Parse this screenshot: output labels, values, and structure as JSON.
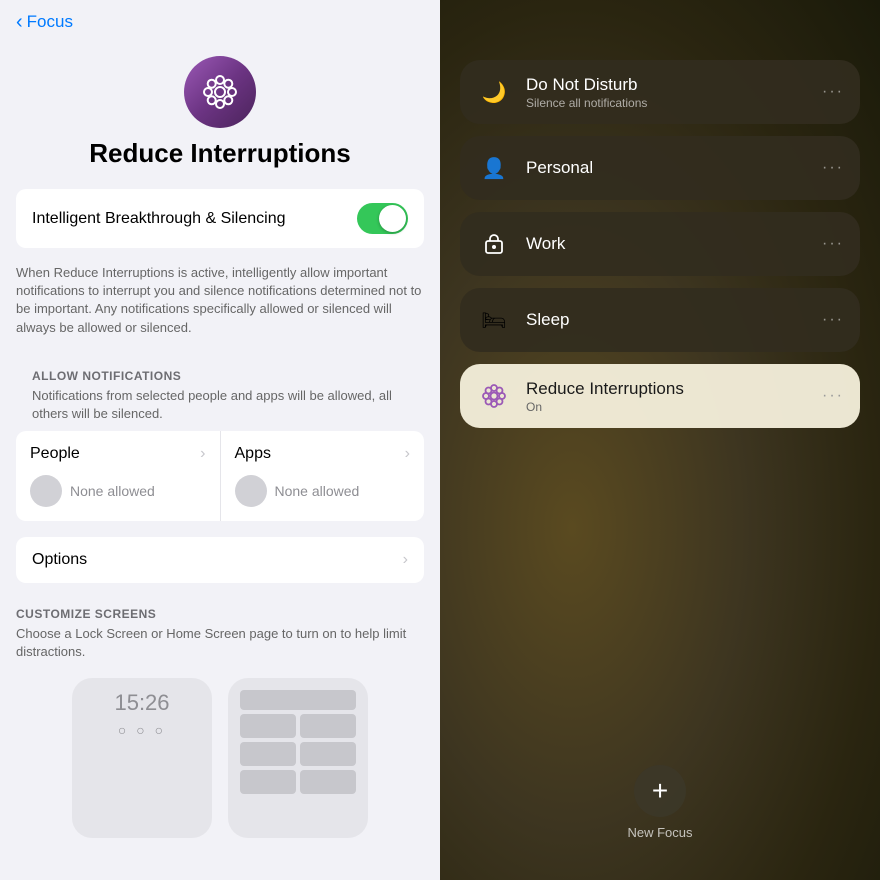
{
  "left": {
    "back_label": "Focus",
    "page_title": "Reduce Interruptions",
    "toggle_label": "Intelligent Breakthrough & Silencing",
    "toggle_on": true,
    "description": "When Reduce Interruptions is active, intelligently allow important notifications to interrupt you and silence notifications determined not to be important. Any notifications specifically allowed or silenced will always be allowed or silenced.",
    "allow_notifications_header": "ALLOW NOTIFICATIONS",
    "allow_notifications_desc": "Notifications from selected people and apps will be allowed, all others will be silenced.",
    "people_label": "People",
    "apps_label": "Apps",
    "people_none": "None allowed",
    "apps_none": "None allowed",
    "options_label": "Options",
    "customize_header": "CUSTOMIZE SCREENS",
    "customize_desc": "Choose a Lock Screen or Home Screen page to turn on to help limit distractions.",
    "screen_time": "15:26"
  },
  "right": {
    "focus_items": [
      {
        "name": "Do Not Disturb",
        "subtitle": "Silence all notifications",
        "icon": "moon",
        "active": false
      },
      {
        "name": "Personal",
        "subtitle": "",
        "icon": "person",
        "active": false
      },
      {
        "name": "Work",
        "subtitle": "",
        "icon": "work",
        "active": false
      },
      {
        "name": "Sleep",
        "subtitle": "",
        "icon": "sleep",
        "active": false
      },
      {
        "name": "Reduce Interruptions",
        "subtitle": "On",
        "icon": "flower",
        "active": true
      }
    ],
    "new_focus_label": "New Focus",
    "new_focus_plus": "+"
  }
}
